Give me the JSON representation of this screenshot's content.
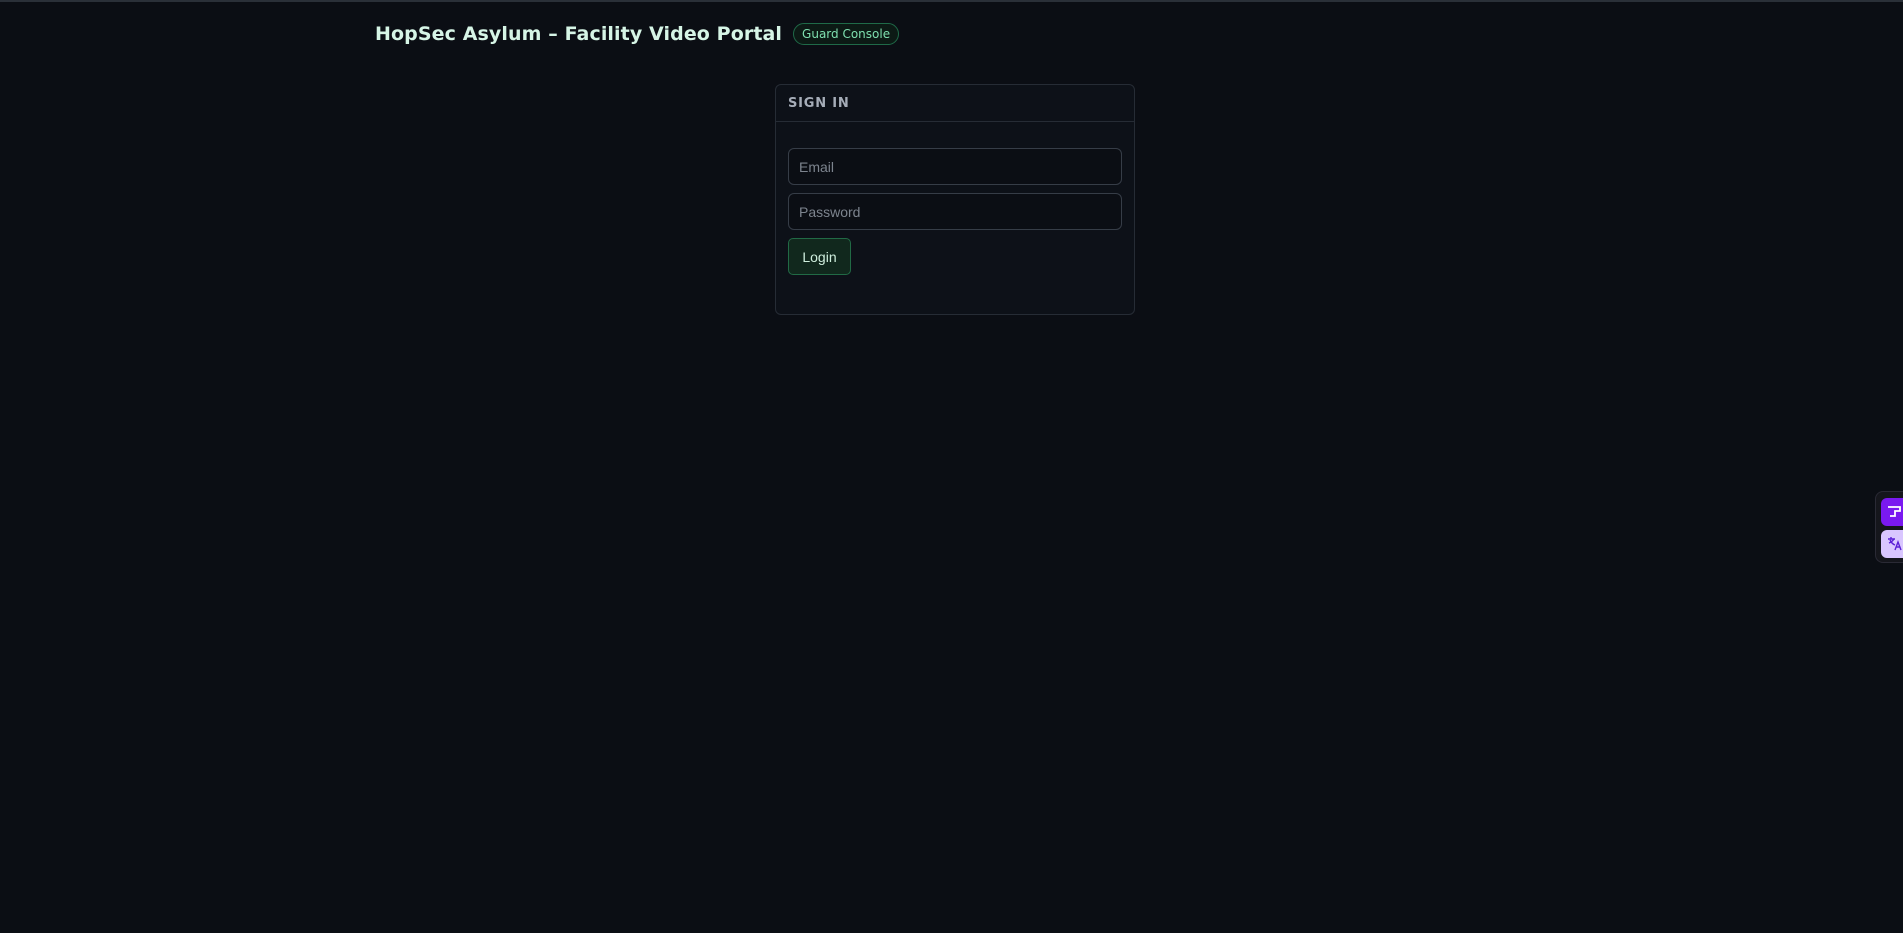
{
  "header": {
    "title": "HopSec Asylum – Facility Video Portal",
    "badge": "Guard Console"
  },
  "login_card": {
    "title": "SIGN IN",
    "email_placeholder": "Email",
    "password_placeholder": "Password",
    "login_label": "Login"
  },
  "side_widget": {
    "icons": [
      "extension-icon",
      "translate-icon"
    ]
  },
  "colors": {
    "background": "#0b0e14",
    "accent": "#7fe0b0",
    "widget_primary": "#7a19f0"
  }
}
